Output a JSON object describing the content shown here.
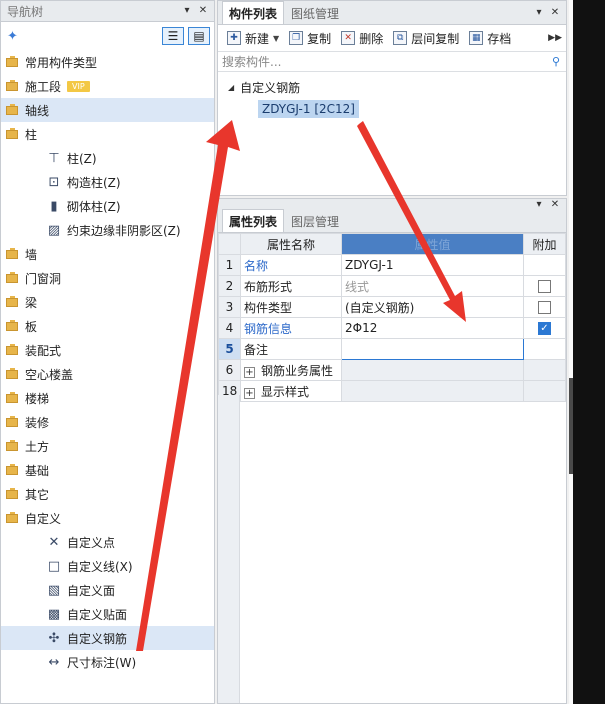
{
  "nav": {
    "title": "导航树",
    "items": [
      {
        "label": "常用构件类型",
        "level": 0
      },
      {
        "label": "施工段",
        "level": 0,
        "badge": "VIP"
      },
      {
        "label": "轴线",
        "level": 0,
        "selected": true
      },
      {
        "label": "柱",
        "level": 0
      },
      {
        "label": "柱(Z)",
        "level": 1,
        "icon": "column-icon"
      },
      {
        "label": "构造柱(Z)",
        "level": 1,
        "icon": "constructional-column-icon"
      },
      {
        "label": "砌体柱(Z)",
        "level": 1,
        "icon": "masonry-column-icon"
      },
      {
        "label": "约束边缘非阴影区(Z)",
        "level": 1,
        "icon": "hatch-area-icon"
      },
      {
        "label": "墙",
        "level": 0
      },
      {
        "label": "门窗洞",
        "level": 0
      },
      {
        "label": "梁",
        "level": 0
      },
      {
        "label": "板",
        "level": 0
      },
      {
        "label": "装配式",
        "level": 0
      },
      {
        "label": "空心楼盖",
        "level": 0
      },
      {
        "label": "楼梯",
        "level": 0
      },
      {
        "label": "装修",
        "level": 0
      },
      {
        "label": "土方",
        "level": 0
      },
      {
        "label": "基础",
        "level": 0
      },
      {
        "label": "其它",
        "level": 0
      },
      {
        "label": "自定义",
        "level": 0
      },
      {
        "label": "自定义点",
        "level": 1,
        "icon": "custom-point-icon"
      },
      {
        "label": "自定义线(X)",
        "level": 1,
        "icon": "custom-line-icon"
      },
      {
        "label": "自定义面",
        "level": 1,
        "icon": "custom-face-icon"
      },
      {
        "label": "自定义贴面",
        "level": 1,
        "icon": "custom-veneer-icon"
      },
      {
        "label": "自定义钢筋",
        "level": 1,
        "icon": "custom-rebar-icon",
        "selected": true
      },
      {
        "label": "尺寸标注(W)",
        "level": 1,
        "icon": "dimension-icon"
      }
    ]
  },
  "components": {
    "tabs": [
      "构件列表",
      "图纸管理"
    ],
    "toolbar": {
      "new": "新建",
      "copy": "复制",
      "delete": "删除",
      "floor_copy": "层间复制",
      "save": "存档"
    },
    "search_placeholder": "搜索构件...",
    "tree_root": "自定义钢筋",
    "tree_child": "ZDYGJ-1 [2C12]"
  },
  "props": {
    "tabs": [
      "属性列表",
      "图层管理"
    ],
    "headers": {
      "name": "属性名称",
      "value": "属性值",
      "add": "附加"
    },
    "rows": [
      {
        "num": "1",
        "name": "名称",
        "value": "ZDYGJ-1"
      },
      {
        "num": "2",
        "name": "布筋形式",
        "value": "线式"
      },
      {
        "num": "3",
        "name": "构件类型",
        "value": "(自定义钢筋)"
      },
      {
        "num": "4",
        "name": "钢筋信息",
        "value": "2Φ12"
      },
      {
        "num": "5",
        "name": "备注",
        "value": ""
      },
      {
        "num": "6",
        "name": "钢筋业务属性",
        "value": ""
      },
      {
        "num": "18",
        "name": "显示样式",
        "value": ""
      }
    ]
  },
  "colors": {
    "accent": "#2b78d3",
    "arrow": "#e8362c",
    "selected_bg": "#dbe7f6"
  }
}
